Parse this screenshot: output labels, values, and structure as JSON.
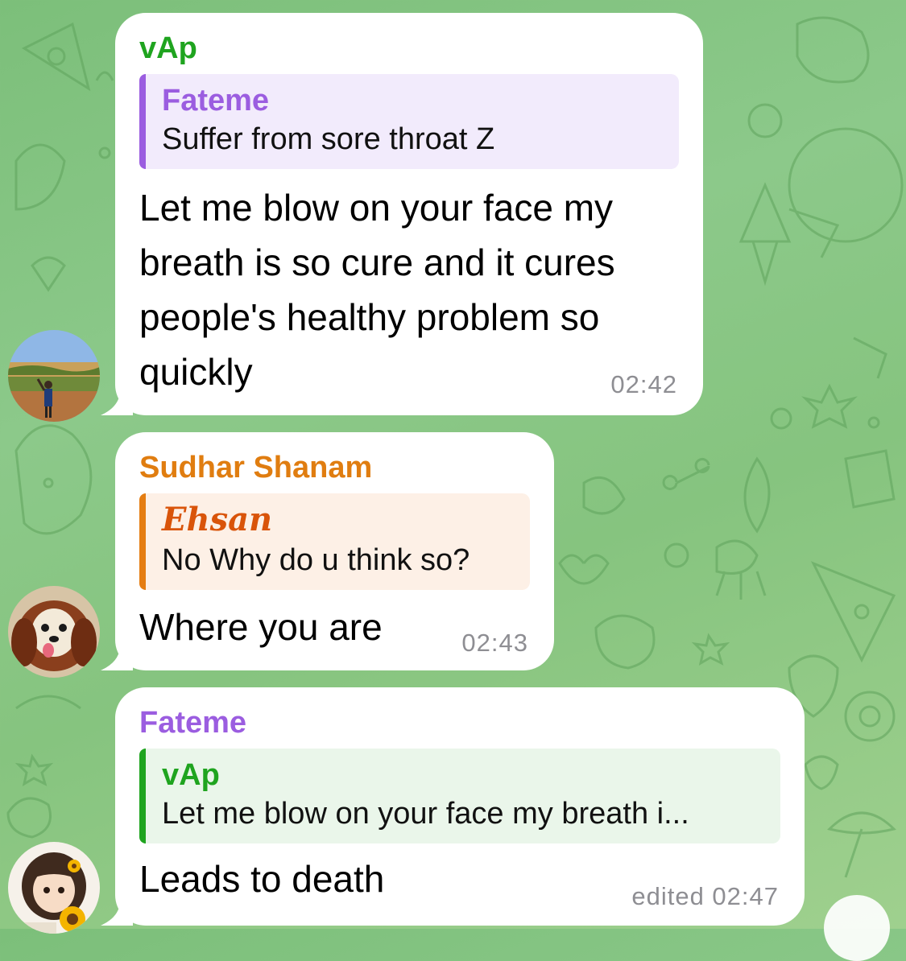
{
  "messages": [
    {
      "sender": "vAp",
      "reply": {
        "name": "Fateme",
        "text": "Suffer from sore throat Z"
      },
      "lines": [
        "Let me blow on your face my",
        "breath is so cure and it cures",
        "people's healthy problem so",
        "quickly"
      ],
      "time": "02:42"
    },
    {
      "sender": "Sudhar Shanam",
      "reply": {
        "name": "Ehsan",
        "text": "No Why do u think so?"
      },
      "text": "Where you are",
      "time": "02:43"
    },
    {
      "sender": "Fateme",
      "reply": {
        "name": "vAp",
        "text": "Let me blow on your face my breath i..."
      },
      "text": "Leads to death",
      "time": "edited 02:47"
    }
  ],
  "colors": {
    "wallpaper": "#86c47f",
    "bubble": "#ffffff",
    "green_name": "#1fa41f",
    "purple_name": "#9b5de0",
    "orange_name": "#e07d10",
    "time": "#8e8e93"
  }
}
